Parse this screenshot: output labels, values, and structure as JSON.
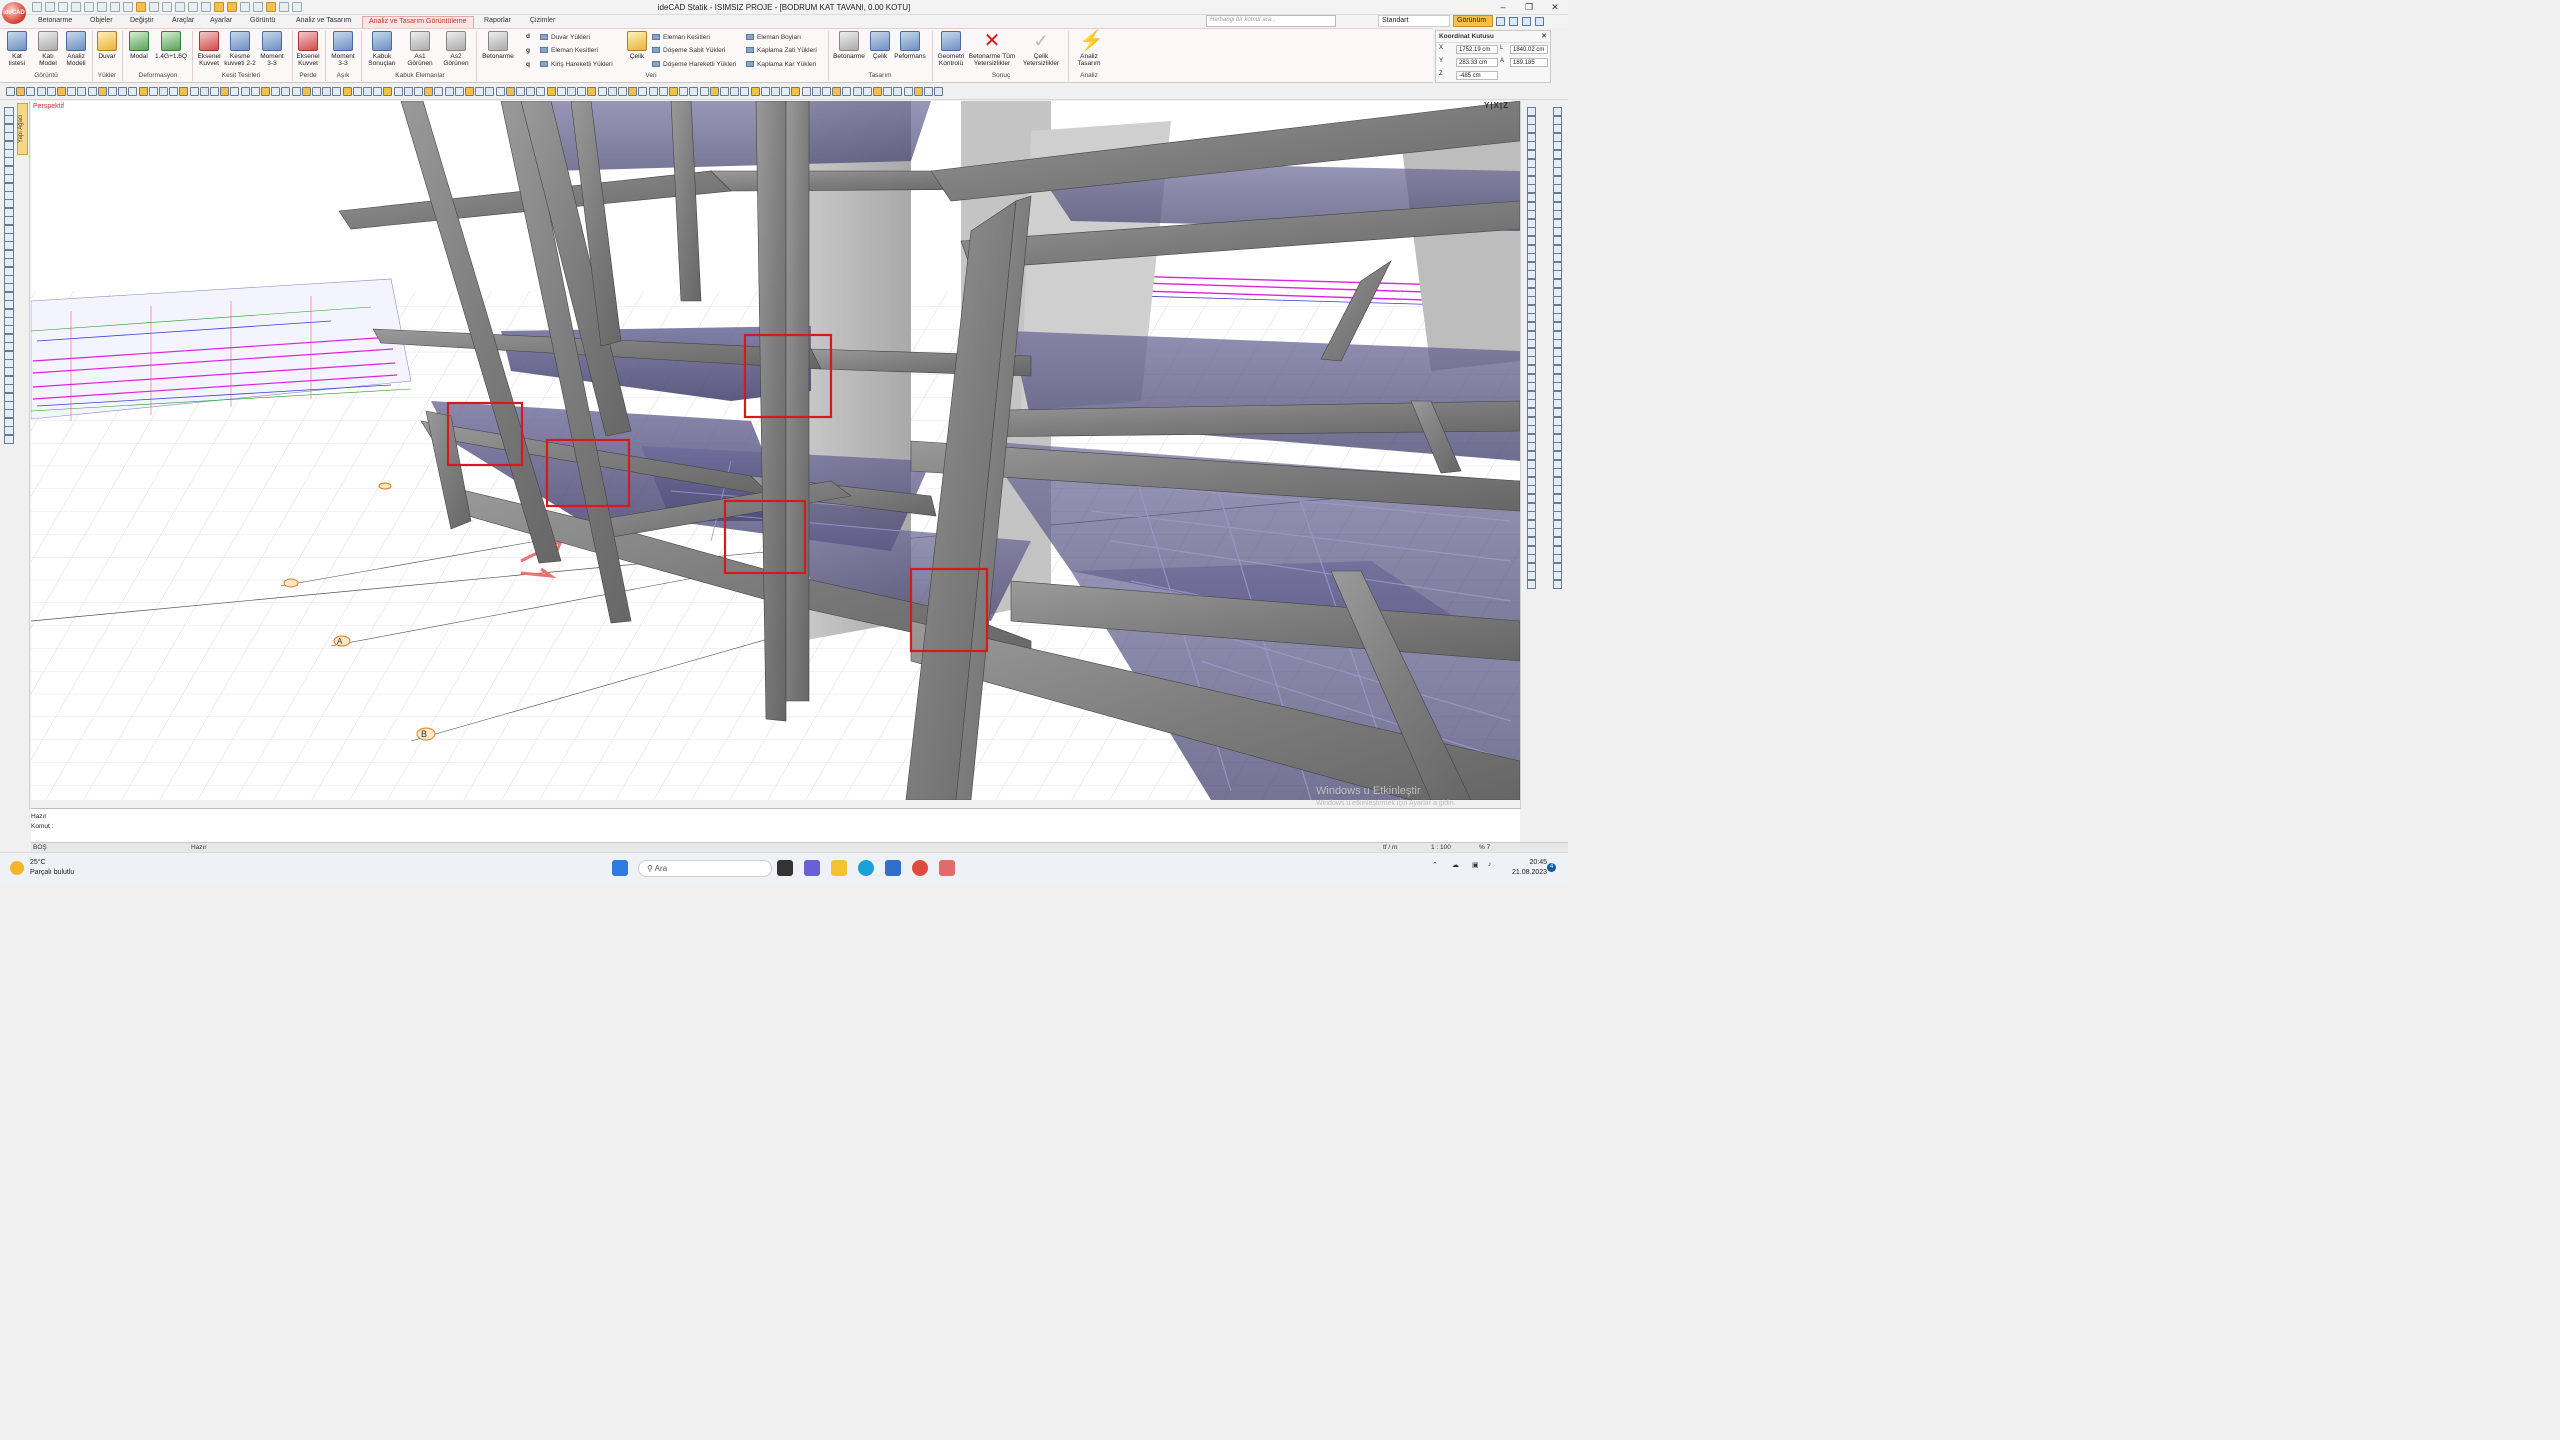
{
  "app": {
    "title": "ideCAD Statik - ISIMSIZ PROJE - [BODRUM  KAT TAVANI,  0.00 KOTU]",
    "logo_text": "ideCAD"
  },
  "tabs": [
    "Betonarme",
    "Objeler",
    "Değiştir",
    "Araçlar",
    "Ayarlar",
    "Görüntü",
    "Analiz ve Tasarım",
    "Analiz ve Tasarım Görüntüleme",
    "Raporlar",
    "Çizimler"
  ],
  "active_tab": "Analiz ve Tasarım Görüntüleme",
  "search": {
    "placeholder": "Herhangi bir komut ara..."
  },
  "style_select": "Standart",
  "view_button": "Görünüm",
  "ribbon": {
    "buttons": [
      {
        "label": "Kat\nlistesi",
        "group": "Görüntü"
      },
      {
        "label": "Katı\nModel",
        "group": "Görüntü"
      },
      {
        "label": "Analiz\nModeli",
        "group": "Görüntü"
      },
      {
        "label": "Duvar",
        "group": "Yükler"
      },
      {
        "label": "Modal",
        "group": "Deformasyon"
      },
      {
        "label": "1.4G+1.6Q",
        "group": "Deformasyon"
      },
      {
        "label": "Eksenel\nKuvvet",
        "group": "Kesit Tesirleri"
      },
      {
        "label": "Kesme\nkuvveti 2-2",
        "group": "Kesit Tesirleri"
      },
      {
        "label": "Moment\n3-3",
        "group": "Kesit Tesirleri"
      },
      {
        "label": "Eksenel\nKuvvet",
        "group": "Perde"
      },
      {
        "label": "Moment\n3-3",
        "group": "Aşık"
      },
      {
        "label": "Kabuk\nSonuçları",
        "group": "Kabuk Elemanlar"
      },
      {
        "label": "As1\nGörünen",
        "group": "Kabuk Elemanlar"
      },
      {
        "label": "As2\nGörünen",
        "group": "Kabuk Elemanlar"
      },
      {
        "label": "Betonarme",
        "group": "Veri"
      },
      {
        "label": "Çelik",
        "group": "Veri"
      },
      {
        "label": "Betonarme",
        "group": "Tasarım"
      },
      {
        "label": "Çelik",
        "group": "Tasarım"
      },
      {
        "label": "Peformans",
        "group": "Tasarım"
      },
      {
        "label": "Geometri\nKontrolü",
        "group": "Sonuç"
      },
      {
        "label": "Betonarme Tüm\nYetersizlikler",
        "group": "Sonuç"
      },
      {
        "label": "Çelik\nYetersizlikler",
        "group": "Sonuç"
      },
      {
        "label": "Analiz\nTasarım",
        "group": "Analiz"
      }
    ],
    "groups": [
      "Görüntü",
      "Yükler",
      "Deformasyon",
      "Kesit Tesirleri",
      "Perde",
      "Aşık",
      "Kabuk Elemanlar",
      "Veri",
      "Tasarım",
      "Sonuç",
      "Analiz"
    ],
    "veri_letters": [
      "d",
      "g",
      "q"
    ],
    "veri_list": [
      "Duvar Yükleri",
      "Eleman Kesitleri",
      "Kiriş Hareketli Yükleri"
    ],
    "veri_list2": [
      "Eleman Kesitleri",
      "Döşeme Sabit Yükleri",
      "Döşeme Hareketli Yükleri"
    ],
    "veri_list3": [
      "Eleman Boyları",
      "Kaplama Zati Yükleri",
      "Kaplama Kar Yükleri"
    ]
  },
  "coordinate_box": {
    "title": "Koordinat Kutusu",
    "x_label": "X",
    "x_value": "1752.19 cm",
    "y_label": "Y",
    "y_value": "283.33 cm",
    "z_label": "Z",
    "z_value": "-485 cm",
    "l_label": "L",
    "l_value": "1840.02 cm",
    "a_label": "A",
    "a_value": "189.185"
  },
  "viewport": {
    "mode_label": "Perspektif",
    "axis_indicator": "Y|X|Z",
    "left_tab": "Yapı Ağacı",
    "axis_bubbles": [
      "A",
      "B"
    ]
  },
  "command": {
    "line1": "Hazır",
    "line2": "Komut :"
  },
  "status": {
    "left": "BOŞ",
    "mid": "Hazır",
    "units": "tf / m",
    "scale": "1 : 100",
    "percent": "% 7"
  },
  "watermark": {
    "line1": "Windows u Etkinleştir",
    "line2": "Windows u etkinleştirmek için Ayarlar a gidin."
  },
  "taskbar": {
    "weather_temp": "25°C",
    "weather_desc": "Parçalı bulutlu",
    "search": "Ara",
    "time": "20:45",
    "date": "21.08.2023",
    "notif_count": "4"
  },
  "highlight_color": "#d41a1a",
  "accent_color": "#c0392b"
}
